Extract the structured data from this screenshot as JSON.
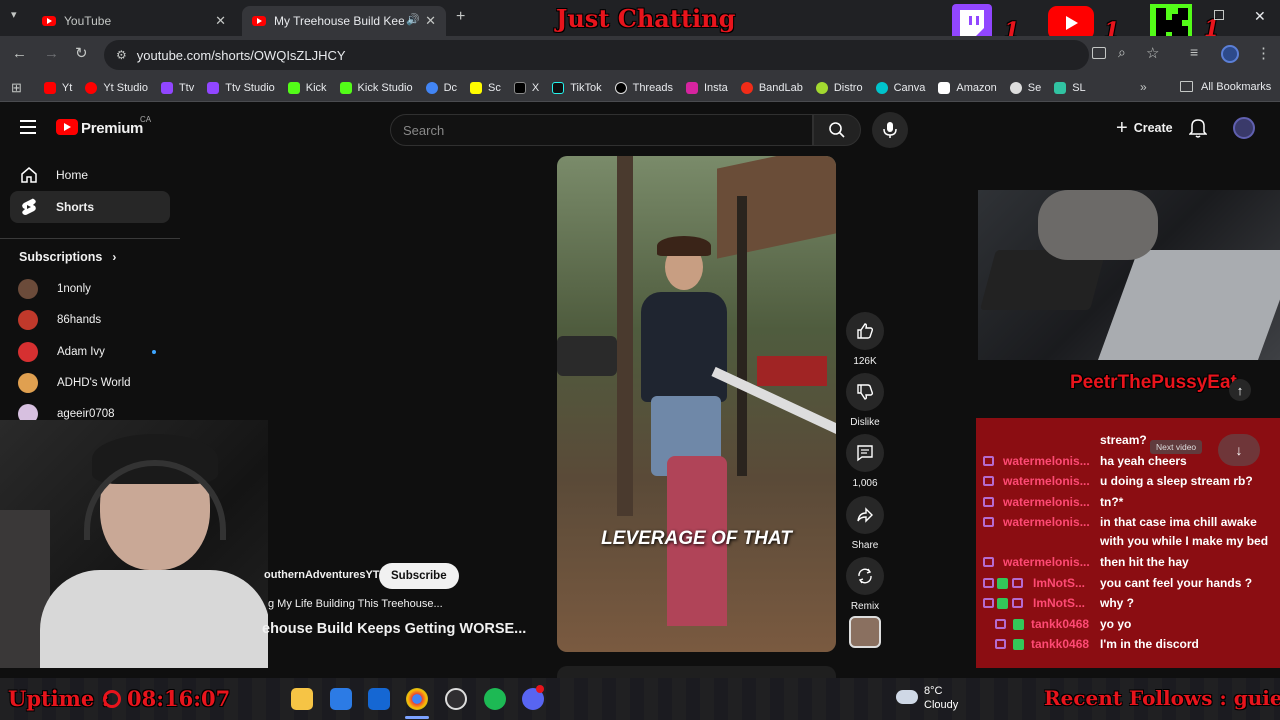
{
  "browser": {
    "tabs": [
      {
        "title": "YouTube"
      },
      {
        "title": "My Treehouse Build Keeps"
      }
    ],
    "url": "youtube.com/shorts/OWQIsZLJHCY",
    "bookmarks": [
      "Yt",
      "Yt Studio",
      "Ttv",
      "Ttv Studio",
      "Kick",
      "Kick Studio",
      "Dc",
      "Sc",
      "X",
      "TikTok",
      "Threads",
      "Insta",
      "BandLab",
      "Distro",
      "Canva",
      "Amazon",
      "Se",
      "SL"
    ],
    "all_bookmarks": "All Bookmarks"
  },
  "stream_overlay": {
    "category": "Just Chatting",
    "counters": [
      "1",
      "1",
      "1"
    ],
    "username_banner": "PeetrThePussyEat",
    "uptime_label": "Uptime :",
    "uptime_value": "08:16:07",
    "recent_follows": "Recent Follows : guiel"
  },
  "youtube": {
    "logo": "Premium",
    "region": "CA",
    "search_placeholder": "Search",
    "create_label": "Create",
    "sidebar": {
      "home": "Home",
      "shorts": "Shorts",
      "subscriptions_heading": "Subscriptions",
      "subscriptions": [
        {
          "name": "1nonly",
          "color": "#6b4b3a"
        },
        {
          "name": "86hands",
          "color": "#c0392b"
        },
        {
          "name": "Adam Ivy",
          "color": "#d63031"
        },
        {
          "name": "ADHD's World",
          "color": "#e0a050"
        },
        {
          "name": "ageeir0708",
          "color": "#d7c0e0"
        }
      ]
    },
    "short": {
      "caption": "LEVERAGE OF THAT",
      "channel": "outhernAdventuresYT",
      "subscribe_label": "Subscribe",
      "description": "g My Life Building This Treehouse...",
      "title": "ehouse Build Keeps Getting WORSE...",
      "likes": "126K",
      "dislike_label": "Dislike",
      "comments": "1,006",
      "share_label": "Share",
      "remix_label": "Remix",
      "next_video_tooltip": "Next video"
    }
  },
  "chat": {
    "messages": [
      {
        "user": "",
        "text": "stream?"
      },
      {
        "user": "watermelonis...",
        "text": "ha yeah cheers"
      },
      {
        "user": "watermelonis...",
        "text": "u doing a sleep stream rb?"
      },
      {
        "user": "watermelonis...",
        "text": "tn?*"
      },
      {
        "user": "watermelonis...",
        "text": "in that case ima chill awake"
      },
      {
        "user": "",
        "text": "with you while I make my bed"
      },
      {
        "user": "watermelonis...",
        "text": "then hit the hay"
      },
      {
        "user": "ImNotS...",
        "text": "you cant feel your hands ?"
      },
      {
        "user": "ImNotS...",
        "text": "why ?"
      },
      {
        "user": "tankk0468",
        "text": "yo yo"
      },
      {
        "user": "tankk0468",
        "text": "I'm in the discord"
      }
    ]
  },
  "taskbar": {
    "temperature": "8°C",
    "weather": "Cloudy"
  }
}
